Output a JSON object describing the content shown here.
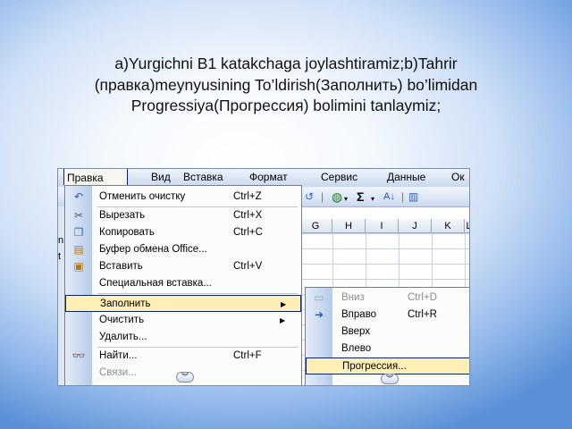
{
  "caption": {
    "line1": "a)Yurgichni B1 katakchaga joylashtiramiz;b)Tahrir",
    "line2": "(правка)meynyusining To’ldirish(Заполнить) bo’limidan",
    "line3": "Progressiya(Прогрессия) bolimini tanlaymiz;"
  },
  "menubar": {
    "items": [
      "Правка",
      "Вид",
      "Вставка",
      "Формат",
      "Сервис",
      "Данные",
      "Ок"
    ]
  },
  "columns": [
    "G",
    "H",
    "I",
    "J",
    "K",
    "L"
  ],
  "left_letters": [
    "n",
    "t"
  ],
  "edit_menu": {
    "items": [
      {
        "label": "Отменить очистку",
        "shortcut": "Ctrl+Z",
        "icon": "undo-icon",
        "glyph": "↶"
      },
      {
        "label": "Вырезать",
        "shortcut": "Ctrl+X",
        "icon": "scissors-icon",
        "glyph": "✂"
      },
      {
        "label": "Копировать",
        "shortcut": "Ctrl+C",
        "icon": "copy-icon",
        "glyph": "❐"
      },
      {
        "label": "Буфер обмена Office...",
        "shortcut": "",
        "icon": "clipboard-icon",
        "glyph": "▤"
      },
      {
        "label": "Вставить",
        "shortcut": "Ctrl+V",
        "icon": "paste-icon",
        "glyph": "📋"
      },
      {
        "label": "Специальная вставка...",
        "shortcut": "",
        "icon": "",
        "glyph": ""
      },
      {
        "label": "Заполнить",
        "shortcut": "",
        "icon": "",
        "glyph": "",
        "submenu": true
      },
      {
        "label": "Очистить",
        "shortcut": "",
        "icon": "",
        "glyph": "",
        "submenu": true
      },
      {
        "label": "Удалить...",
        "shortcut": "",
        "icon": "",
        "glyph": ""
      },
      {
        "label": "Найти...",
        "shortcut": "Ctrl+F",
        "icon": "binoculars-icon",
        "glyph": "⌕"
      },
      {
        "label": "Связи...",
        "shortcut": "",
        "icon": "",
        "glyph": ""
      }
    ]
  },
  "fill_submenu": {
    "items": [
      {
        "label": "Вниз",
        "shortcut": "Ctrl+D"
      },
      {
        "label": "Вправо",
        "shortcut": "Ctrl+R"
      },
      {
        "label": "Вверх",
        "shortcut": ""
      },
      {
        "label": "Влево",
        "shortcut": ""
      },
      {
        "label": "Прогрессия...",
        "shortcut": ""
      }
    ]
  },
  "colors": {
    "highlight": "#ffeeb5",
    "highlight_border": "#0a246a"
  }
}
